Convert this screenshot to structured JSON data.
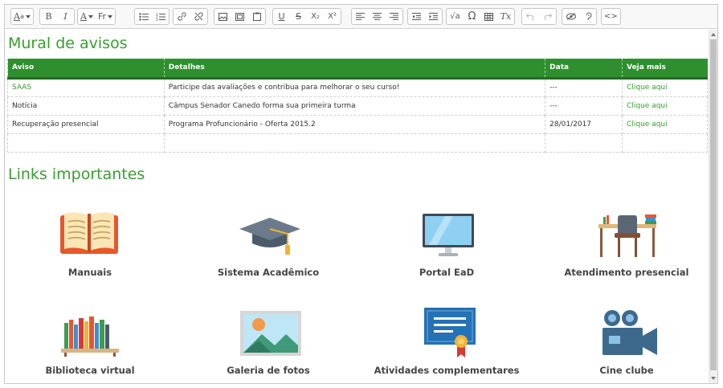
{
  "toolbar": {
    "styles_label": "A",
    "font_color_label": "A",
    "format_label": "Fr",
    "bold": "B",
    "italic": "I",
    "underline": "U",
    "strike": "S",
    "subscript": "X₂",
    "superscript": "X²",
    "math": "√a",
    "omega": "Ω",
    "clear_format": "Tx",
    "source": "<>"
  },
  "mural": {
    "title": "Mural de avisos",
    "headers": [
      "Aviso",
      "Detalhes",
      "Data",
      "Veja mais"
    ],
    "rows": [
      {
        "aviso": "SAAS",
        "detalhes": "Participe das avaliações e contribua para melhorar o seu curso!",
        "data": "---",
        "veja": "Clique aqui"
      },
      {
        "aviso": "Notícia",
        "detalhes": "Câmpus Senador Canedo forma sua primeira turma",
        "data": "---",
        "veja": "Clique aqui"
      },
      {
        "aviso": "Recuperação presencial",
        "detalhes": "Programa Profuncionário - Oferta 2015.2",
        "data": "28/01/2017",
        "veja": "Clique aqui"
      },
      {
        "aviso": "",
        "detalhes": "",
        "data": "",
        "veja": ""
      }
    ]
  },
  "links": {
    "title": "Links importantes",
    "items": [
      {
        "label": "Manuais",
        "icon": "book-icon"
      },
      {
        "label": "Sistema Acadêmico",
        "icon": "graduation-cap-icon"
      },
      {
        "label": "Portal EaD",
        "icon": "monitor-icon"
      },
      {
        "label": "Atendimento presencial",
        "icon": "desk-chair-icon"
      },
      {
        "label": "Biblioteca virtual",
        "icon": "bookshelf-icon"
      },
      {
        "label": "Galeria de fotos",
        "icon": "photo-icon"
      },
      {
        "label": "Atividades complementares",
        "icon": "certificate-icon"
      },
      {
        "label": "Cine clube",
        "icon": "movie-camera-icon"
      }
    ]
  },
  "colors": {
    "accent": "#3a9c2f",
    "table_header": "#2f8f2f"
  }
}
